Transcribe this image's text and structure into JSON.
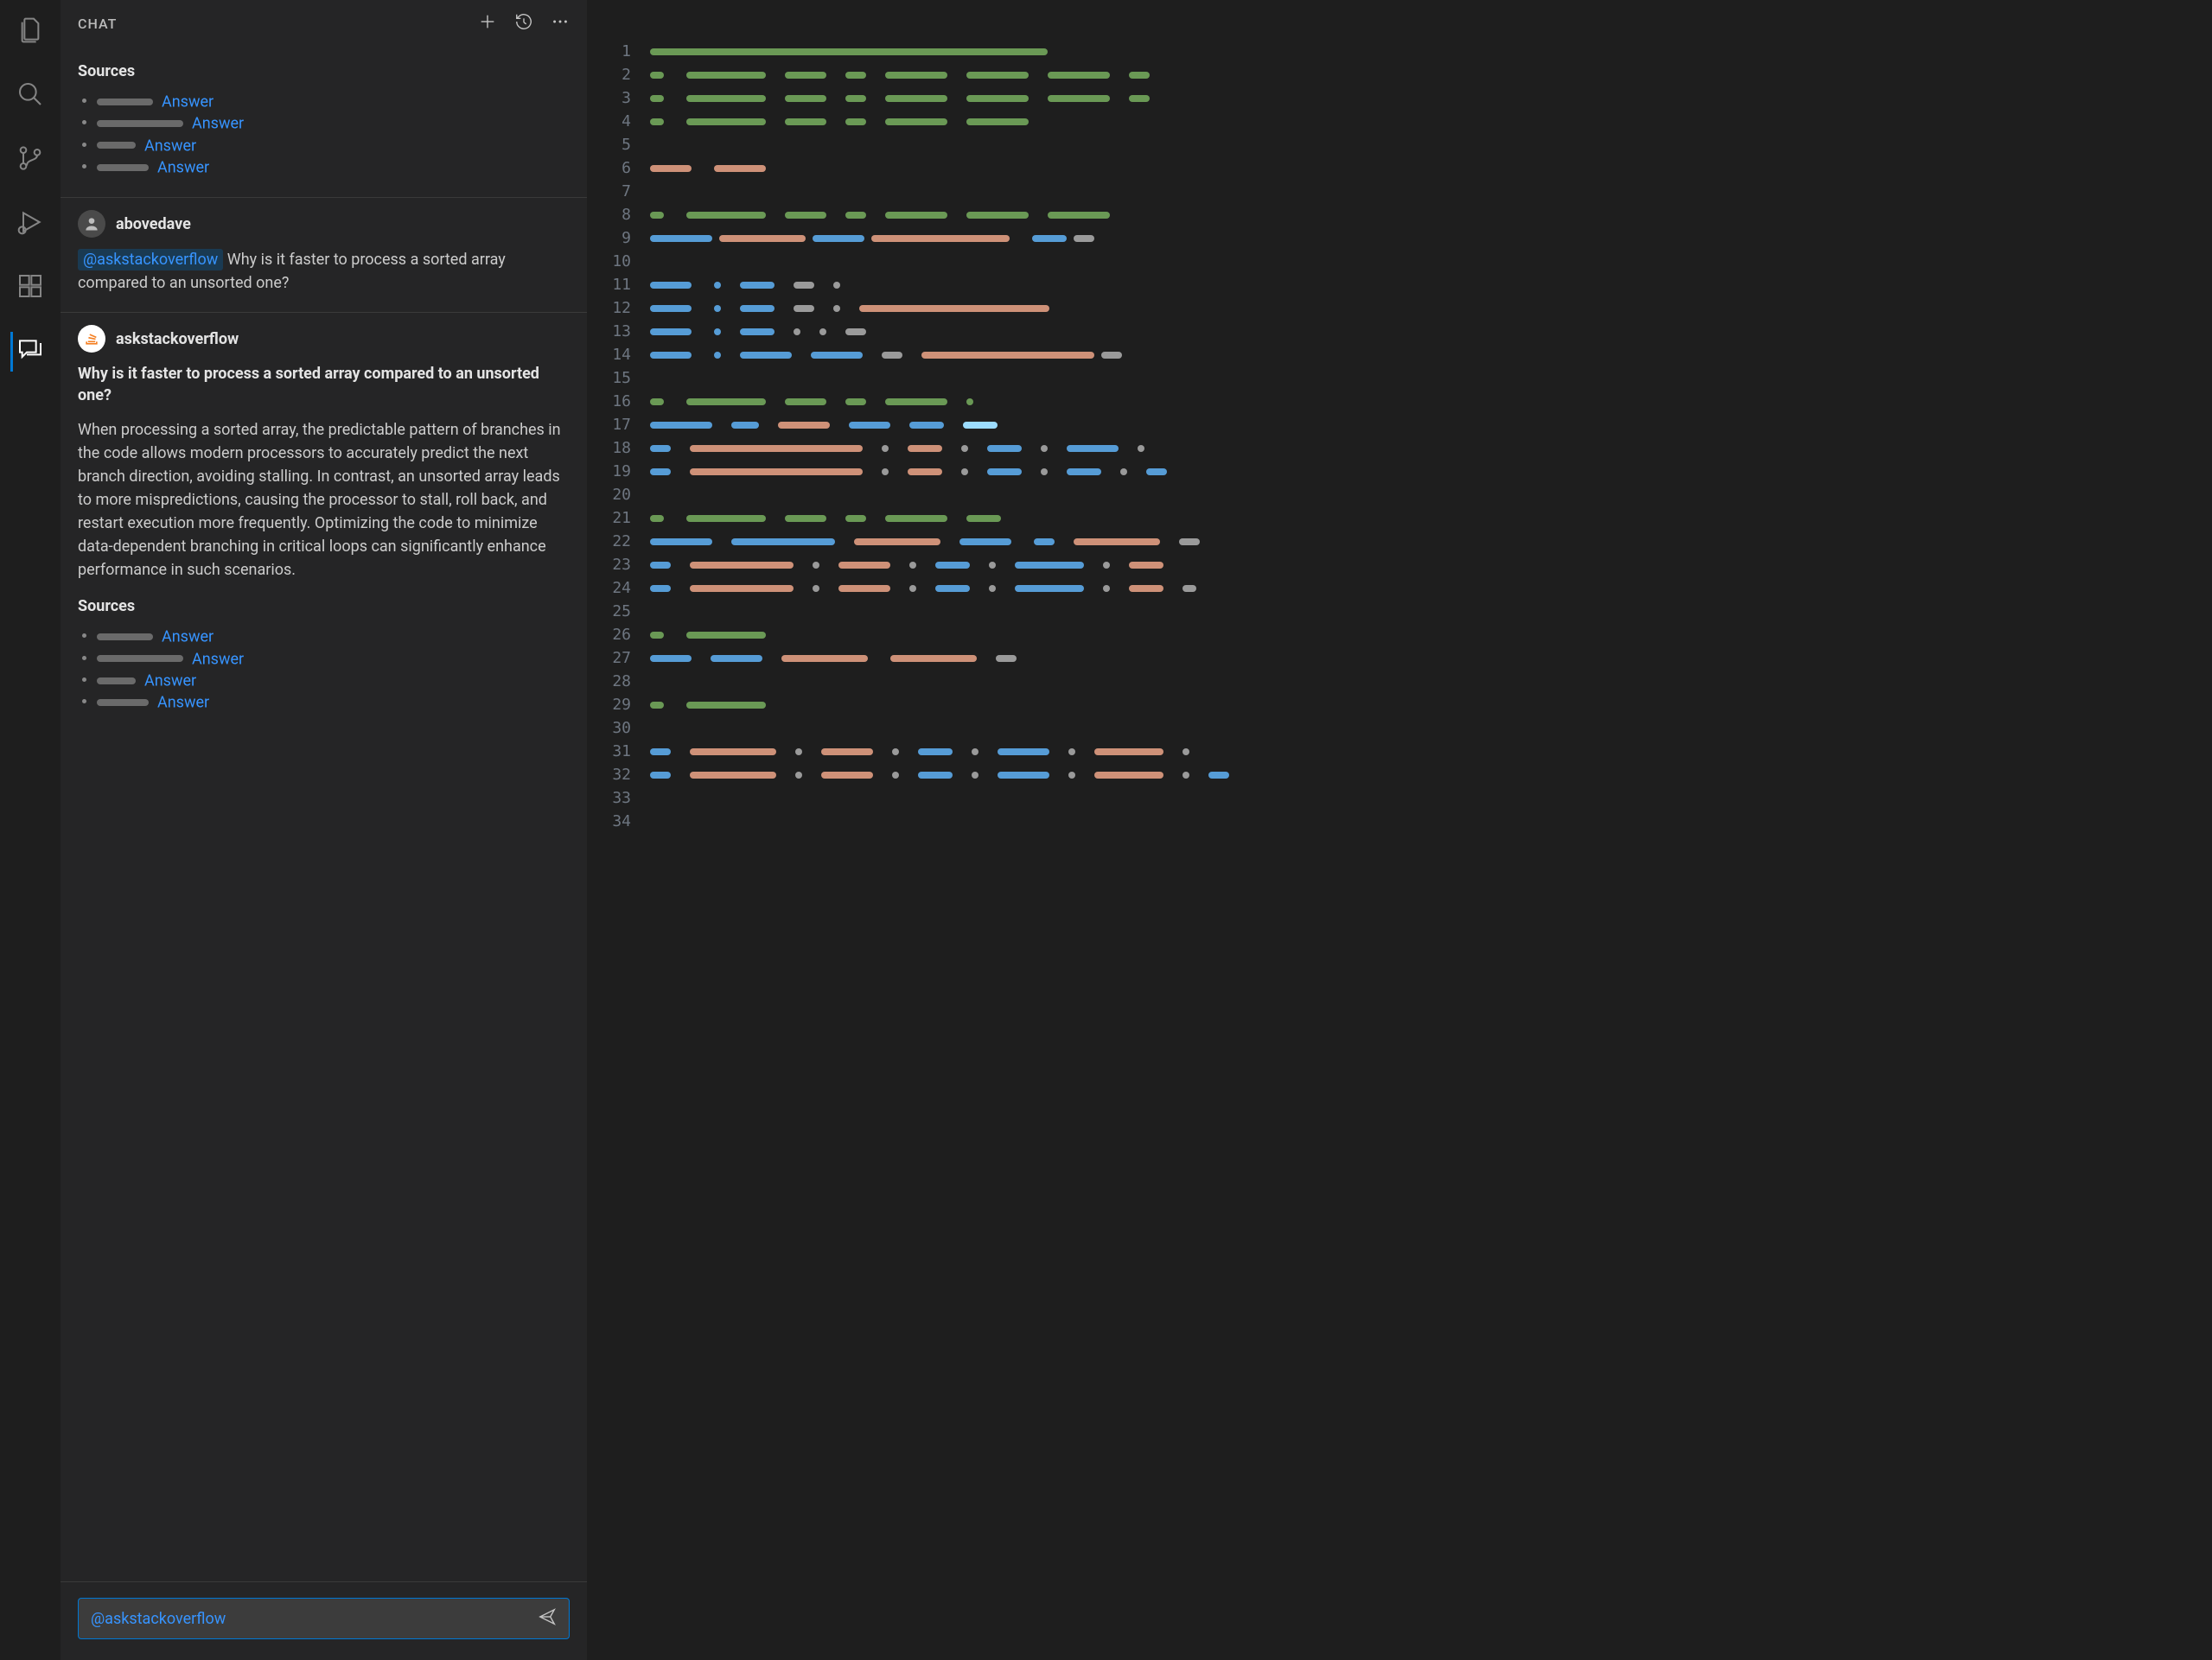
{
  "panel": {
    "title": "CHAT"
  },
  "topSources": {
    "heading": "Sources",
    "items": [
      {
        "barWidth": 65,
        "link": "Answer"
      },
      {
        "barWidth": 100,
        "link": "Answer"
      },
      {
        "barWidth": 45,
        "link": "Answer"
      },
      {
        "barWidth": 60,
        "link": "Answer"
      }
    ]
  },
  "userMsg": {
    "name": "abovedave",
    "mention": "@askstackoverflow",
    "text": "Why is it faster to process a sorted array compared to an unsorted one?"
  },
  "botMsg": {
    "name": "askstackoverflow",
    "title": "Why is it faster to process a sorted array compared to an unsorted one?",
    "body": "When processing a sorted array, the predictable pattern of branches in the code allows modern processors to accurately predict the next branch direction, avoiding stalling. In contrast, an unsorted array leads to more mispredictions, causing the processor to stall, roll back, and restart execution more frequently. Optimizing the code to minimize data-dependent branching in critical loops can significantly enhance performance in such scenarios.",
    "sourcesHeading": "Sources",
    "sources": [
      {
        "barWidth": 65,
        "link": "Answer"
      },
      {
        "barWidth": 100,
        "link": "Answer"
      },
      {
        "barWidth": 45,
        "link": "Answer"
      },
      {
        "barWidth": 60,
        "link": "Answer"
      }
    ]
  },
  "input": {
    "mention": "@askstackoverflow"
  },
  "editor": {
    "lines": [
      [
        [
          "green",
          460
        ]
      ],
      [
        [
          "green",
          16
        ],
        [
          "",
          10
        ],
        [
          "green",
          92
        ],
        [
          "",
          6
        ],
        [
          "green",
          48
        ],
        [
          "",
          6
        ],
        [
          "green",
          24
        ],
        [
          "",
          6
        ],
        [
          "green",
          72
        ],
        [
          "",
          6
        ],
        [
          "green",
          72
        ],
        [
          "",
          6
        ],
        [
          "green",
          72
        ],
        [
          "",
          6
        ],
        [
          "green",
          24
        ]
      ],
      [
        [
          "green",
          16
        ],
        [
          "",
          10
        ],
        [
          "green",
          92
        ],
        [
          "",
          6
        ],
        [
          "green",
          48
        ],
        [
          "",
          6
        ],
        [
          "green",
          24
        ],
        [
          "",
          6
        ],
        [
          "green",
          72
        ],
        [
          "",
          6
        ],
        [
          "green",
          72
        ],
        [
          "",
          6
        ],
        [
          "green",
          72
        ],
        [
          "",
          6
        ],
        [
          "green",
          24
        ]
      ],
      [
        [
          "green",
          16
        ],
        [
          "",
          10
        ],
        [
          "green",
          92
        ],
        [
          "",
          6
        ],
        [
          "green",
          48
        ],
        [
          "",
          6
        ],
        [
          "green",
          24
        ],
        [
          "",
          6
        ],
        [
          "green",
          72
        ],
        [
          "",
          6
        ],
        [
          "green",
          72
        ]
      ],
      [],
      [
        [
          "orange",
          48
        ],
        [
          "",
          10
        ],
        [
          "orange",
          60
        ]
      ],
      [],
      [
        [
          "green",
          16
        ],
        [
          "",
          10
        ],
        [
          "green",
          92
        ],
        [
          "",
          6
        ],
        [
          "green",
          48
        ],
        [
          "",
          6
        ],
        [
          "green",
          24
        ],
        [
          "",
          6
        ],
        [
          "green",
          72
        ],
        [
          "",
          6
        ],
        [
          "green",
          72
        ],
        [
          "",
          6
        ],
        [
          "green",
          72
        ]
      ],
      [
        [
          "blue",
          72
        ],
        [
          "orange",
          100
        ],
        [
          "blue",
          60
        ],
        [
          "orange",
          160
        ],
        [
          "",
          10
        ],
        [
          "blue",
          40
        ],
        [
          "grey",
          24
        ]
      ],
      [],
      [
        [
          "blue",
          48
        ],
        [
          "",
          10
        ],
        [
          "blue",
          8
        ],
        [
          "",
          6
        ],
        [
          "blue",
          40
        ],
        [
          "",
          6
        ],
        [
          "grey",
          24
        ],
        [
          "",
          6
        ],
        [
          "grey",
          8
        ]
      ],
      [
        [
          "blue",
          48
        ],
        [
          "",
          10
        ],
        [
          "blue",
          8
        ],
        [
          "",
          6
        ],
        [
          "blue",
          40
        ],
        [
          "",
          6
        ],
        [
          "grey",
          24
        ],
        [
          "",
          6
        ],
        [
          "grey",
          8
        ],
        [
          "",
          6
        ],
        [
          "orange",
          220
        ]
      ],
      [
        [
          "blue",
          48
        ],
        [
          "",
          10
        ],
        [
          "blue",
          8
        ],
        [
          "",
          6
        ],
        [
          "blue",
          40
        ],
        [
          "",
          6
        ],
        [
          "grey",
          8
        ],
        [
          "",
          6
        ],
        [
          "grey",
          8
        ],
        [
          "",
          6
        ],
        [
          "grey",
          24
        ]
      ],
      [
        [
          "blue",
          48
        ],
        [
          "",
          10
        ],
        [
          "blue",
          8
        ],
        [
          "",
          6
        ],
        [
          "blue",
          60
        ],
        [
          "",
          6
        ],
        [
          "blue",
          60
        ],
        [
          "",
          6
        ],
        [
          "grey",
          24
        ],
        [
          "",
          6
        ],
        [
          "orange",
          200
        ],
        [
          "grey",
          24
        ]
      ],
      [],
      [
        [
          "green",
          16
        ],
        [
          "",
          10
        ],
        [
          "green",
          92
        ],
        [
          "",
          6
        ],
        [
          "green",
          48
        ],
        [
          "",
          6
        ],
        [
          "green",
          24
        ],
        [
          "",
          6
        ],
        [
          "green",
          72
        ],
        [
          "",
          6
        ],
        [
          "green",
          8
        ]
      ],
      [
        [
          "blue",
          72
        ],
        [
          "",
          6
        ],
        [
          "blue",
          32
        ],
        [
          "",
          6
        ],
        [
          "orange",
          60
        ],
        [
          "",
          6
        ],
        [
          "blue",
          48
        ],
        [
          "",
          6
        ],
        [
          "blue",
          40
        ],
        [
          "",
          6
        ],
        [
          "lblue",
          40
        ]
      ],
      [
        [
          "blue",
          24
        ],
        [
          "",
          6
        ],
        [
          "orange",
          200
        ],
        [
          "",
          6
        ],
        [
          "grey",
          8
        ],
        [
          "",
          6
        ],
        [
          "orange",
          40
        ],
        [
          "",
          6
        ],
        [
          "grey",
          8
        ],
        [
          "",
          6
        ],
        [
          "blue",
          40
        ],
        [
          "",
          6
        ],
        [
          "grey",
          8
        ],
        [
          "",
          6
        ],
        [
          "blue",
          60
        ],
        [
          "",
          6
        ],
        [
          "grey",
          8
        ]
      ],
      [
        [
          "blue",
          24
        ],
        [
          "",
          6
        ],
        [
          "orange",
          200
        ],
        [
          "",
          6
        ],
        [
          "grey",
          8
        ],
        [
          "",
          6
        ],
        [
          "orange",
          40
        ],
        [
          "",
          6
        ],
        [
          "grey",
          8
        ],
        [
          "",
          6
        ],
        [
          "blue",
          40
        ],
        [
          "",
          6
        ],
        [
          "grey",
          8
        ],
        [
          "",
          6
        ],
        [
          "blue",
          40
        ],
        [
          "",
          6
        ],
        [
          "grey",
          8
        ],
        [
          "",
          6
        ],
        [
          "blue",
          24
        ]
      ],
      [],
      [
        [
          "green",
          16
        ],
        [
          "",
          10
        ],
        [
          "green",
          92
        ],
        [
          "",
          6
        ],
        [
          "green",
          48
        ],
        [
          "",
          6
        ],
        [
          "green",
          24
        ],
        [
          "",
          6
        ],
        [
          "green",
          72
        ],
        [
          "",
          6
        ],
        [
          "green",
          40
        ]
      ],
      [
        [
          "blue",
          72
        ],
        [
          "",
          6
        ],
        [
          "blue",
          120
        ],
        [
          "",
          6
        ],
        [
          "orange",
          100
        ],
        [
          "",
          6
        ],
        [
          "blue",
          60
        ],
        [
          "",
          10
        ],
        [
          "blue",
          24
        ],
        [
          "",
          6
        ],
        [
          "orange",
          100
        ],
        [
          "",
          6
        ],
        [
          "grey",
          24
        ]
      ],
      [
        [
          "blue",
          24
        ],
        [
          "",
          6
        ],
        [
          "orange",
          120
        ],
        [
          "",
          6
        ],
        [
          "grey",
          8
        ],
        [
          "",
          6
        ],
        [
          "orange",
          60
        ],
        [
          "",
          6
        ],
        [
          "grey",
          8
        ],
        [
          "",
          6
        ],
        [
          "blue",
          40
        ],
        [
          "",
          6
        ],
        [
          "grey",
          8
        ],
        [
          "",
          6
        ],
        [
          "blue",
          80
        ],
        [
          "",
          6
        ],
        [
          "grey",
          8
        ],
        [
          "",
          6
        ],
        [
          "orange",
          40
        ]
      ],
      [
        [
          "blue",
          24
        ],
        [
          "",
          6
        ],
        [
          "orange",
          120
        ],
        [
          "",
          6
        ],
        [
          "grey",
          8
        ],
        [
          "",
          6
        ],
        [
          "orange",
          60
        ],
        [
          "",
          6
        ],
        [
          "grey",
          8
        ],
        [
          "",
          6
        ],
        [
          "blue",
          40
        ],
        [
          "",
          6
        ],
        [
          "grey",
          8
        ],
        [
          "",
          6
        ],
        [
          "blue",
          80
        ],
        [
          "",
          6
        ],
        [
          "grey",
          8
        ],
        [
          "",
          6
        ],
        [
          "orange",
          40
        ],
        [
          "",
          6
        ],
        [
          "grey",
          16
        ]
      ],
      [],
      [
        [
          "green",
          16
        ],
        [
          "",
          10
        ],
        [
          "green",
          92
        ]
      ],
      [
        [
          "blue",
          48
        ],
        [
          "",
          6
        ],
        [
          "blue",
          60
        ],
        [
          "",
          6
        ],
        [
          "orange",
          100
        ],
        [
          "",
          10
        ],
        [
          "orange",
          100
        ],
        [
          "",
          6
        ],
        [
          "grey",
          24
        ]
      ],
      [],
      [
        [
          "green",
          16
        ],
        [
          "",
          10
        ],
        [
          "green",
          92
        ]
      ],
      [],
      [
        [
          "blue",
          24
        ],
        [
          "",
          6
        ],
        [
          "orange",
          100
        ],
        [
          "",
          6
        ],
        [
          "grey",
          8
        ],
        [
          "",
          6
        ],
        [
          "orange",
          60
        ],
        [
          "",
          6
        ],
        [
          "grey",
          8
        ],
        [
          "",
          6
        ],
        [
          "blue",
          40
        ],
        [
          "",
          6
        ],
        [
          "grey",
          8
        ],
        [
          "",
          6
        ],
        [
          "blue",
          60
        ],
        [
          "",
          6
        ],
        [
          "grey",
          8
        ],
        [
          "",
          6
        ],
        [
          "orange",
          80
        ],
        [
          "",
          6
        ],
        [
          "grey",
          8
        ]
      ],
      [
        [
          "blue",
          24
        ],
        [
          "",
          6
        ],
        [
          "orange",
          100
        ],
        [
          "",
          6
        ],
        [
          "grey",
          8
        ],
        [
          "",
          6
        ],
        [
          "orange",
          60
        ],
        [
          "",
          6
        ],
        [
          "grey",
          8
        ],
        [
          "",
          6
        ],
        [
          "blue",
          40
        ],
        [
          "",
          6
        ],
        [
          "grey",
          8
        ],
        [
          "",
          6
        ],
        [
          "blue",
          60
        ],
        [
          "",
          6
        ],
        [
          "grey",
          8
        ],
        [
          "",
          6
        ],
        [
          "orange",
          80
        ],
        [
          "",
          6
        ],
        [
          "grey",
          8
        ],
        [
          "",
          6
        ],
        [
          "blue",
          24
        ]
      ],
      [],
      []
    ]
  }
}
